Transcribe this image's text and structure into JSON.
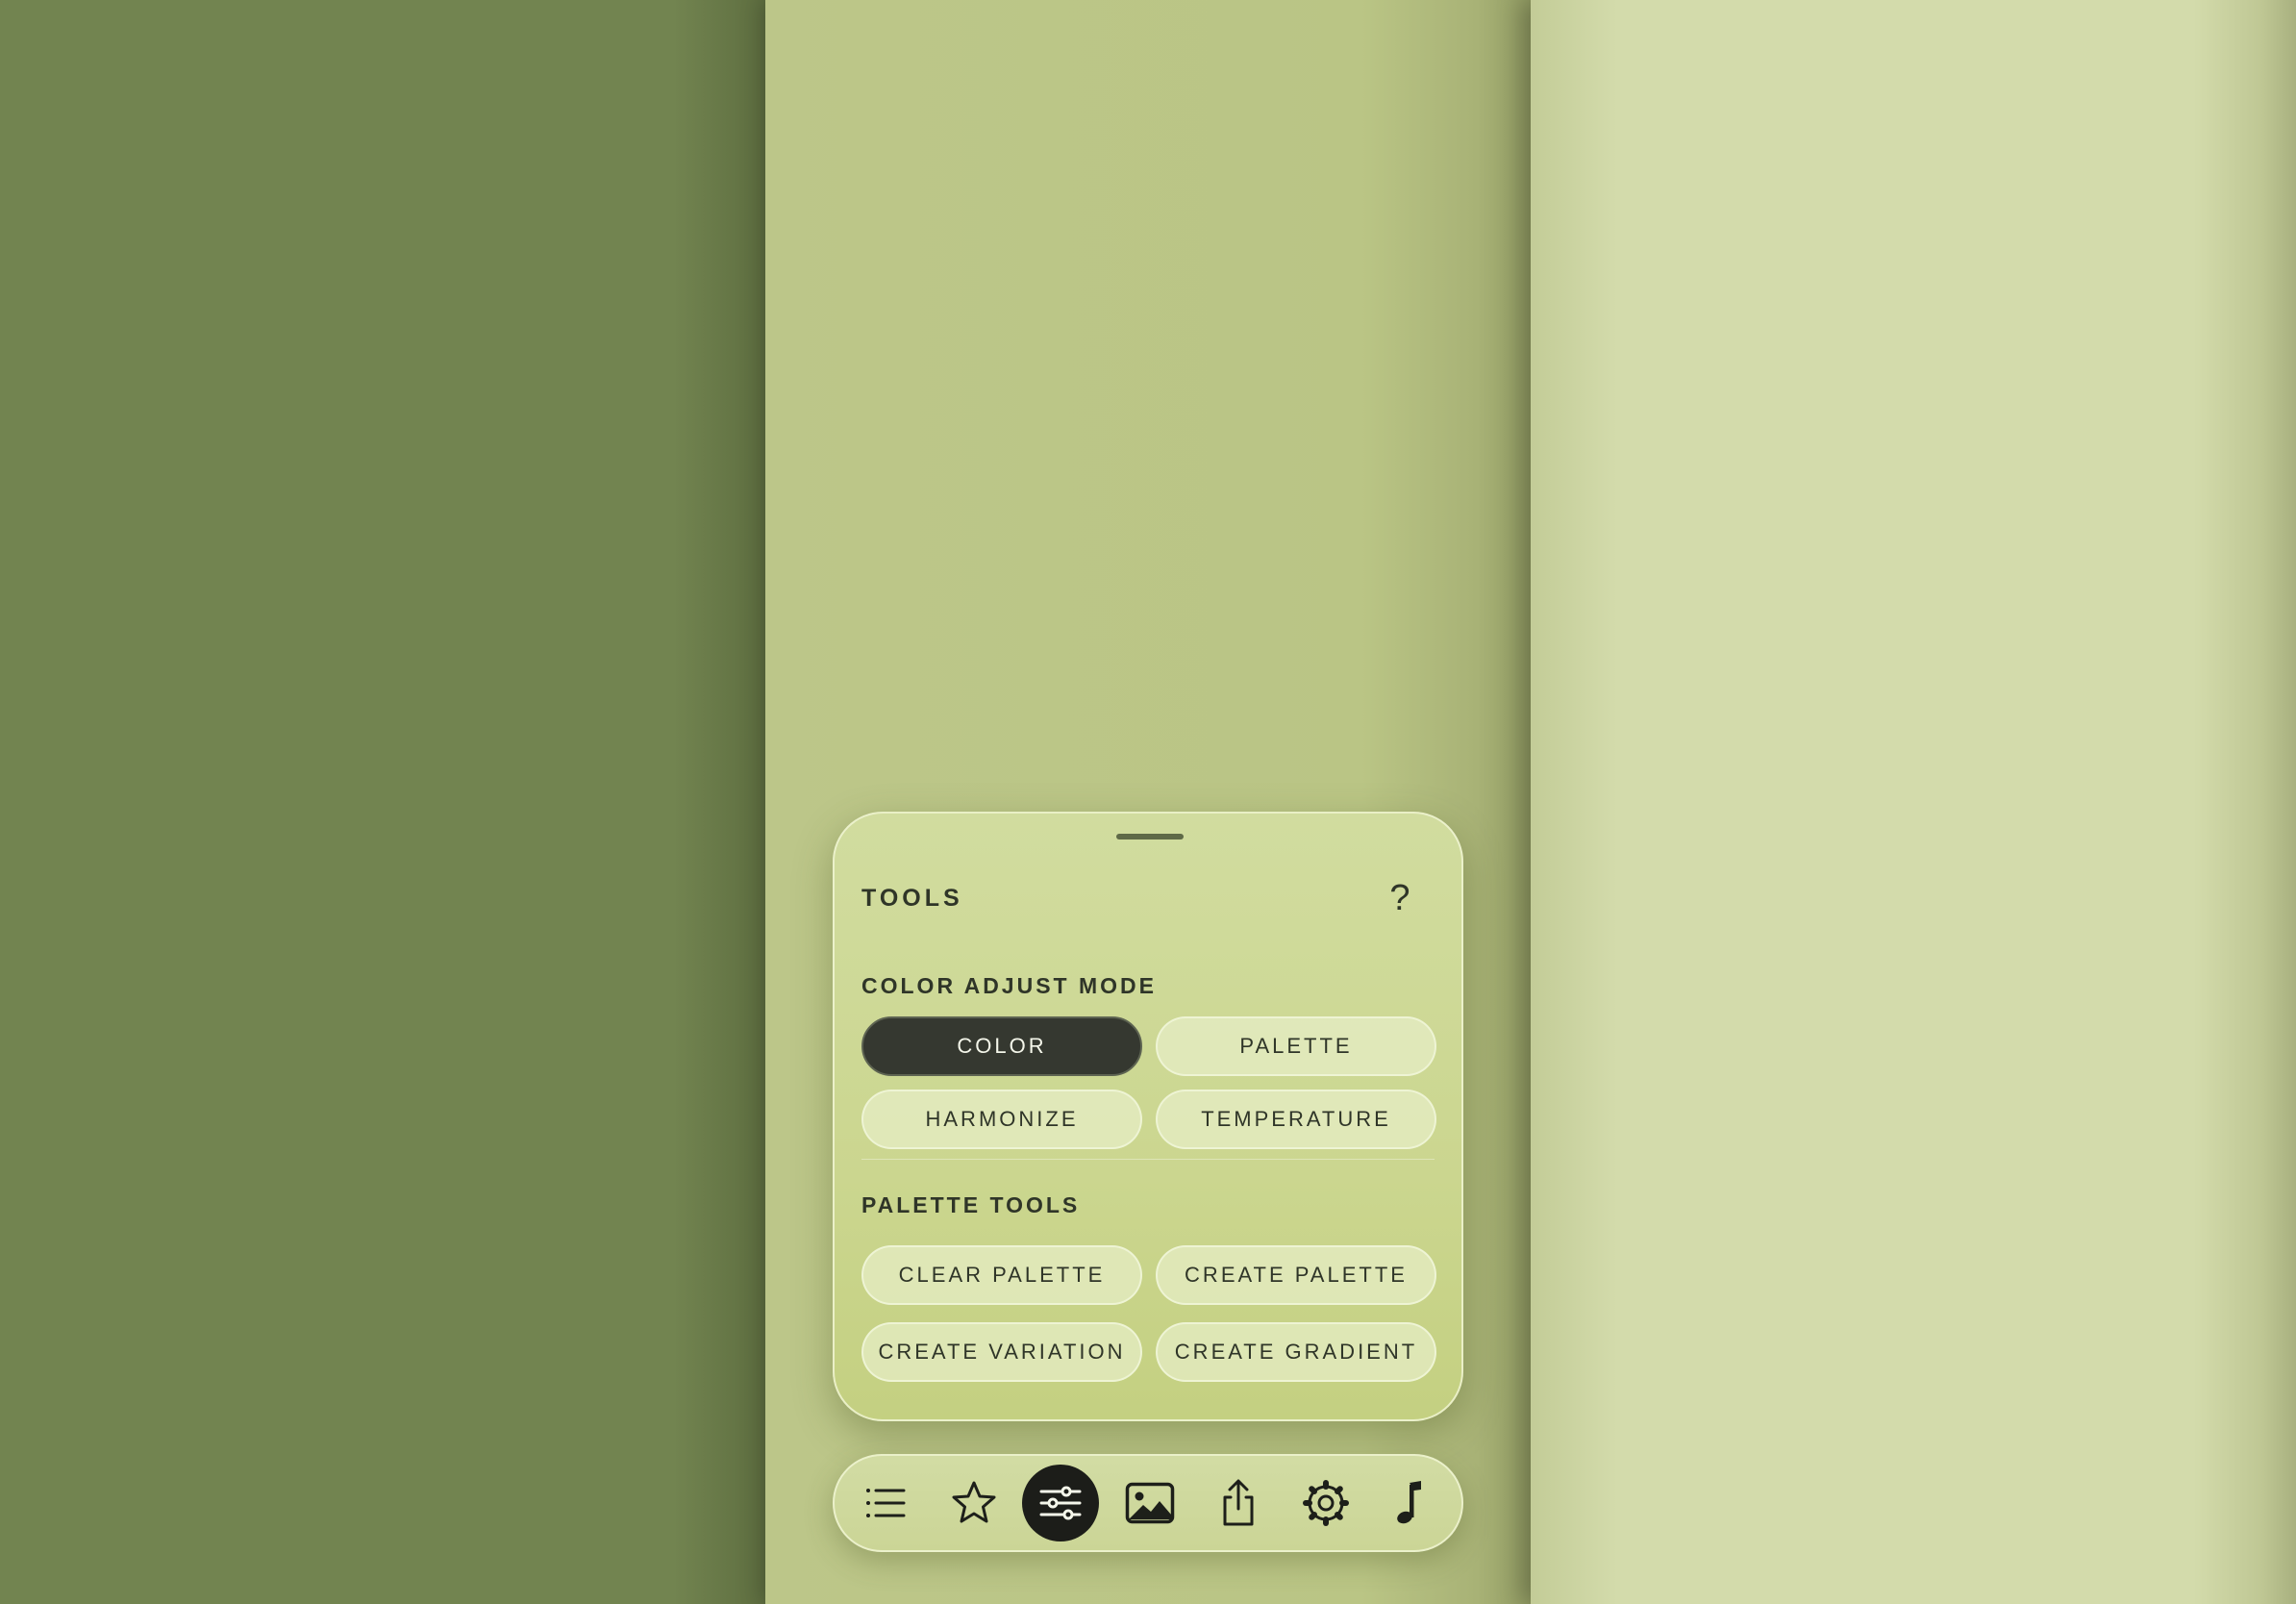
{
  "panel": {
    "title": "TOOLS",
    "help_label": "?",
    "color_adjust": {
      "label": "COLOR ADJUST MODE",
      "options": [
        {
          "label": "COLOR",
          "selected": true
        },
        {
          "label": "PALETTE",
          "selected": false
        },
        {
          "label": "HARMONIZE",
          "selected": false
        },
        {
          "label": "TEMPERATURE",
          "selected": false
        }
      ]
    },
    "palette_tools": {
      "label": "PALETTE TOOLS",
      "buttons": [
        {
          "label": "CLEAR PALETTE"
        },
        {
          "label": "CREATE PALETTE"
        },
        {
          "label": "CREATE VARIATION"
        },
        {
          "label": "CREATE GRADIENT"
        }
      ]
    }
  },
  "toolbar": {
    "items": [
      {
        "icon": "list-icon",
        "active": false
      },
      {
        "icon": "star-icon",
        "active": false
      },
      {
        "icon": "sliders-icon",
        "active": true
      },
      {
        "icon": "image-icon",
        "active": false
      },
      {
        "icon": "share-icon",
        "active": false
      },
      {
        "icon": "gear-icon",
        "active": false
      },
      {
        "icon": "music-note-icon",
        "active": false
      }
    ]
  },
  "colors": {
    "swatch_1": "#728450",
    "swatch_2": "#bcc689",
    "swatch_3": "#d3dbab",
    "accent_dark": "#353830",
    "toolbar_active": "#1c1d19"
  }
}
